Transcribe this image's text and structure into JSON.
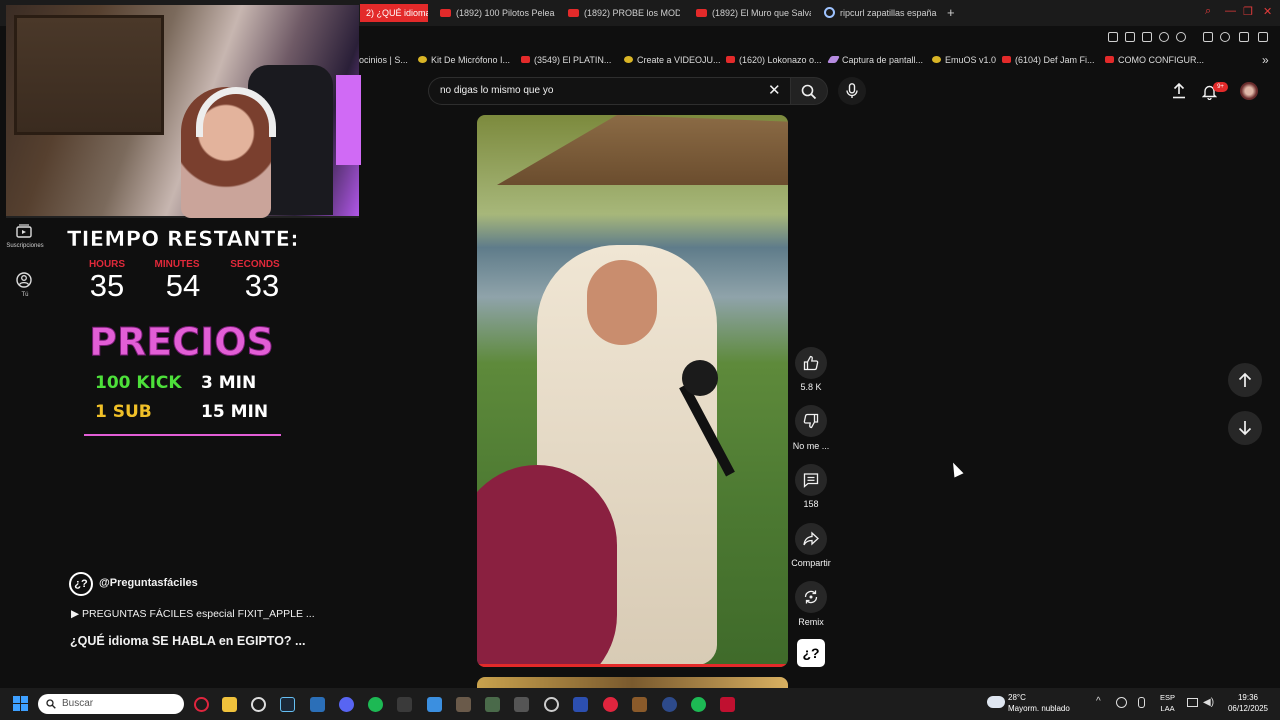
{
  "browser": {
    "tabs": [
      {
        "label": "2) ¿QUÉ idioma S",
        "active": true
      },
      {
        "label": "(1892) 100 Pilotos Pelean"
      },
      {
        "label": "(1892) PROBE los MODS"
      },
      {
        "label": "(1892) El Muro que Salva"
      },
      {
        "label": "ripcurl zapatillas españa"
      }
    ],
    "new_tab": "+",
    "bookmarks": [
      "ocinios | S...",
      "Kit De Micrófono I...",
      "(3549) El PLATIN...",
      "Create a VIDEOJU...",
      "(1620) Lokonazo o...",
      "Captura de pantall...",
      "EmuOS v1.0",
      "(6104) Def Jam Fi...",
      "COMO CONFIGUR..."
    ],
    "bookmarks_more": "»"
  },
  "overlay": {
    "title": "TIEMPO RESTANTE:",
    "timer": {
      "hours_label": "HOURS",
      "hours": "35",
      "minutes_label": "MINUTES",
      "minutes": "54",
      "seconds_label": "SECONDS",
      "seconds": "33"
    },
    "prices_title": "PRECIOS",
    "prices": [
      {
        "item": "100 KICK",
        "time": "3 MIN",
        "color": "#4de03a"
      },
      {
        "item": "1 SUB",
        "time": "15 MIN",
        "color": "#f0c028"
      }
    ]
  },
  "sidebar": {
    "items": [
      {
        "label": "Suscripciones",
        "icon": "subscriptions-icon"
      },
      {
        "label": "Tú",
        "icon": "you-icon"
      }
    ]
  },
  "search": {
    "query": "no digas lo mismo que yo"
  },
  "header": {
    "notification_count": "9+"
  },
  "video": {
    "progress": 1.0,
    "channel_handle": "@Preguntasfáciles",
    "channel_avatar_text": "¿?",
    "playlist": "▶ PREGUNTAS FÁCILES especial FIXIT_APPLE ...",
    "title": "¿QUÉ idioma SE  HABLA en EGIPTO? ..."
  },
  "actions": {
    "like_count": "5.8 K",
    "dislike_label": "No me ...",
    "comments_count": "158",
    "share_label": "Compartir",
    "remix_label": "Remix"
  },
  "taskbar": {
    "search_placeholder": "Buscar",
    "weather_temp": "28°C",
    "weather_desc": "Mayorm. nublado",
    "lang_1": "ESP",
    "lang_2": "LAA",
    "time": "19:36",
    "date": "06/12/2025"
  }
}
